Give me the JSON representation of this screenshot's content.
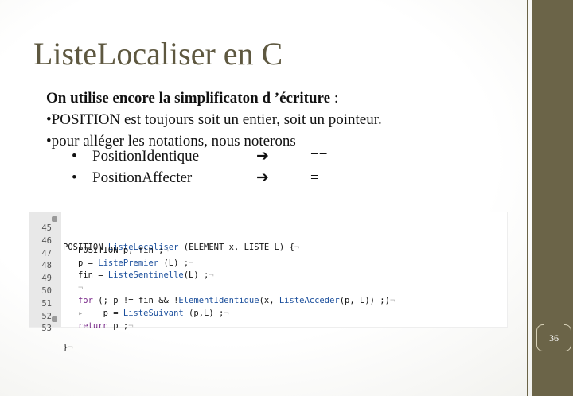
{
  "slide": {
    "title": "ListeLocaliser en C",
    "page_number": "36"
  },
  "text": {
    "intro_bold": "On utilise encore la simplificaton d ’écriture",
    "intro_colon": " :",
    "line1": "•POSITION est toujours soit un entier, soit un pointeur.",
    "line2": "•pour alléger les notations, nous noterons"
  },
  "bullets": [
    {
      "dot": "•",
      "name": "PositionIdentique",
      "arrow": "➔",
      "op": "=="
    },
    {
      "dot": "•",
      "name": "PositionAffecter",
      "arrow": "➔",
      "op": "="
    }
  ],
  "code": {
    "line_numbers": [
      "45",
      "46",
      "47",
      "48",
      "49",
      "50",
      "51",
      "52",
      "53"
    ],
    "l45": {
      "a": "POSITION ",
      "fn": "ListeLocaliser",
      "b": " (ELEMENT x, LISTE L) {",
      "inv": "¬"
    },
    "l46": {
      "a": "   POSITION p, fin ;",
      "inv": "¬"
    },
    "l47": {
      "a": "   p = ",
      "fn": "ListePremier",
      "b": " (L) ;",
      "inv": "¬"
    },
    "l48": {
      "a": "   fin = ",
      "fn": "ListeSentinelle",
      "b": "(L) ;",
      "inv": "¬"
    },
    "l49": {
      "inv": "   ¬"
    },
    "l50": {
      "ctl": "   for",
      "a": " (; p != fin && !",
      "fn": "ElementIdentique",
      "b": "(x, ",
      "fn2": "ListeAcceder",
      "c": "(p, L)) ;)",
      "inv": "¬"
    },
    "l51": {
      "tri": "   ▸",
      "a": "    p = ",
      "fn": "ListeSuivant",
      "b": " (p,L) ;",
      "inv": "¬"
    },
    "l52": {
      "ctl": "   return",
      "a": " p ;",
      "inv": "¬"
    },
    "l53": {
      "a": "}",
      "inv": "¬"
    }
  }
}
